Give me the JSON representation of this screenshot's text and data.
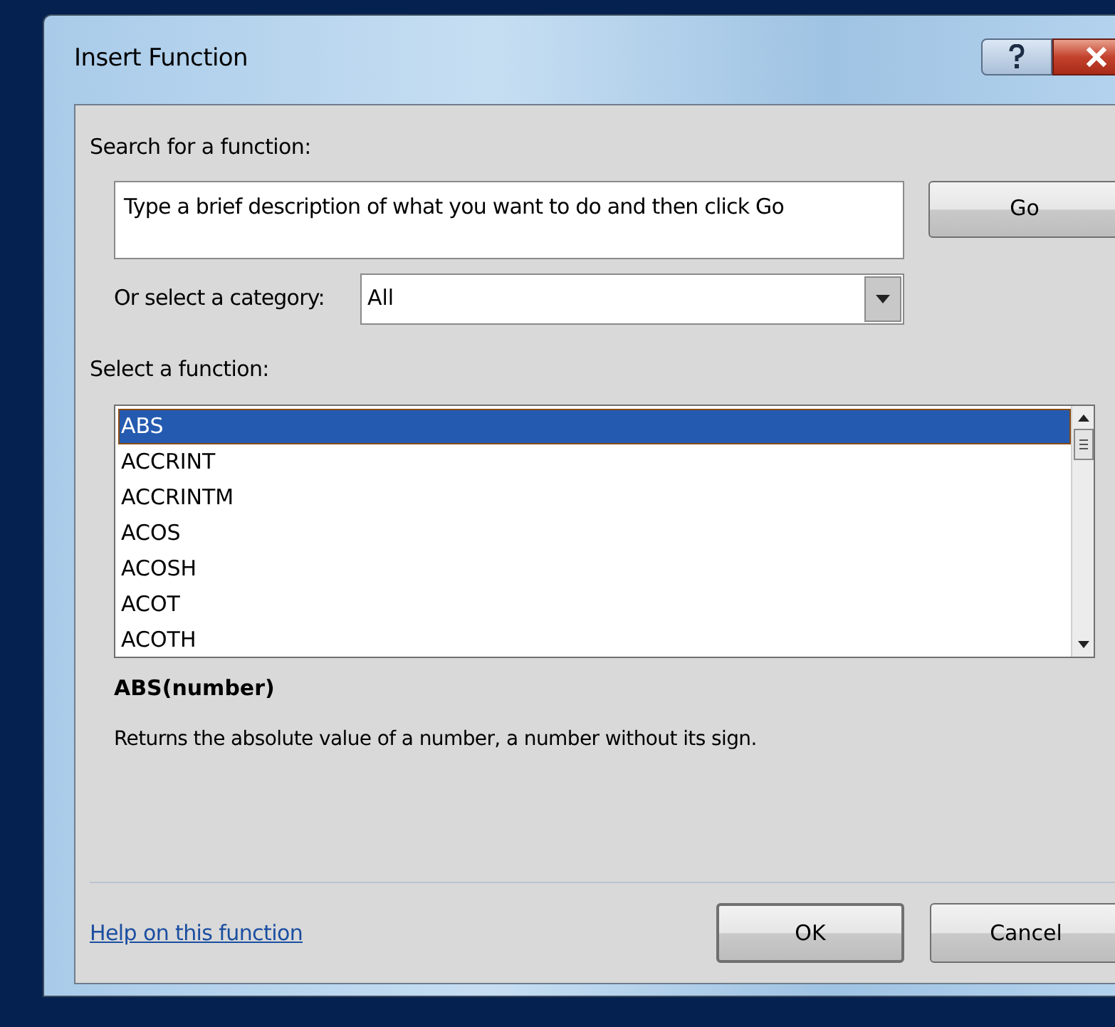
{
  "window": {
    "title": "Insert Function"
  },
  "search": {
    "label": "Search for a function:",
    "value": "Type a brief description of what you want to do and then click Go",
    "button": "Go"
  },
  "category": {
    "label": "Or select a category:",
    "value": "All"
  },
  "functions": {
    "label": "Select a function:",
    "items": [
      {
        "name": "ABS",
        "selected": true
      },
      {
        "name": "ACCRINT",
        "selected": false
      },
      {
        "name": "ACCRINTM",
        "selected": false
      },
      {
        "name": "ACOS",
        "selected": false
      },
      {
        "name": "ACOSH",
        "selected": false
      },
      {
        "name": "ACOT",
        "selected": false
      },
      {
        "name": "ACOTH",
        "selected": false
      }
    ]
  },
  "signature": "ABS(number)",
  "description": "Returns the absolute value of a number, a number without its sign.",
  "help_link": "Help on this function",
  "buttons": {
    "ok": "OK",
    "cancel": "Cancel"
  }
}
